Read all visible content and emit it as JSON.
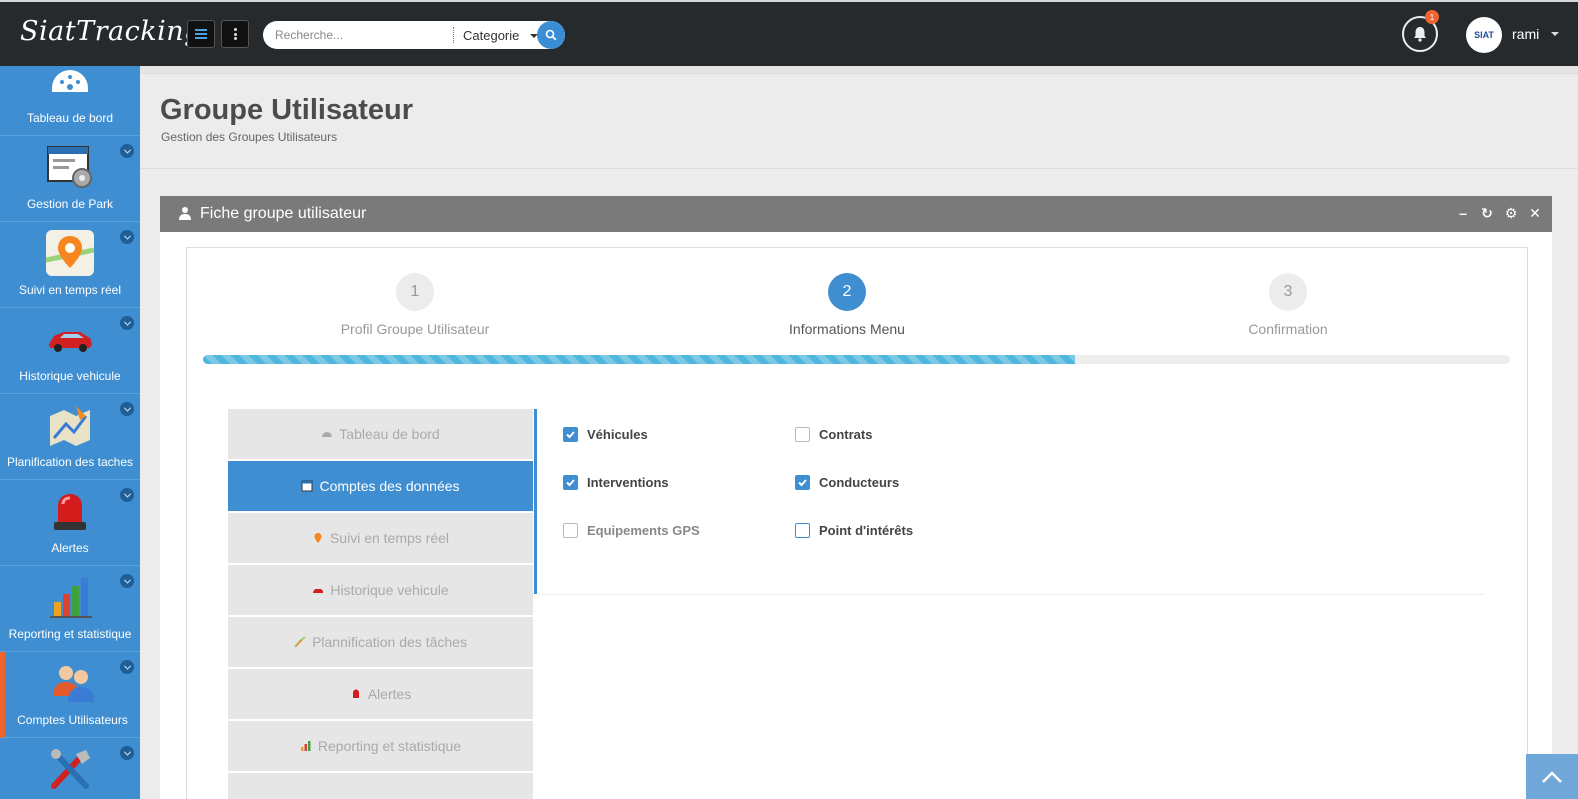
{
  "app": {
    "logo": "SiatTracking"
  },
  "topbar": {
    "search_placeholder": "Recherche...",
    "category": "Categorie",
    "notification_count": "1",
    "avatar_text": "SIAT",
    "username": "rami"
  },
  "sidebar": {
    "items": [
      {
        "label": "Tableau de bord"
      },
      {
        "label": "Gestion de Park"
      },
      {
        "label": "Suivi en temps réel"
      },
      {
        "label": "Historique vehicule"
      },
      {
        "label": "Planification des taches"
      },
      {
        "label": "Alertes"
      },
      {
        "label": "Reporting et statistique"
      },
      {
        "label": "Comptes Utilisateurs"
      },
      {
        "label": ""
      }
    ]
  },
  "page": {
    "title": "Groupe Utilisateur",
    "subtitle": "Gestion des Groupes Utilisateurs"
  },
  "panel": {
    "title": "Fiche groupe utilisateur"
  },
  "wizard": {
    "steps": [
      {
        "num": "1",
        "label": "Profil Groupe Utilisateur"
      },
      {
        "num": "2",
        "label": "Informations Menu"
      },
      {
        "num": "3",
        "label": "Confirmation"
      }
    ],
    "current_step": 2,
    "progress_fraction": 0.667
  },
  "tabs": [
    {
      "label": "Tableau de bord"
    },
    {
      "label": "Comptes des données"
    },
    {
      "label": "Suivi en temps réel"
    },
    {
      "label": "Historique vehicule"
    },
    {
      "label": "Plannification des tâches"
    },
    {
      "label": "Alertes"
    },
    {
      "label": "Reporting et statistique"
    }
  ],
  "options": [
    {
      "label": "Véhicules",
      "checked": true
    },
    {
      "label": "Contrats",
      "checked": false
    },
    {
      "label": "Interventions",
      "checked": true
    },
    {
      "label": "Conducteurs",
      "checked": true
    },
    {
      "label": "Equipements GPS",
      "checked": false
    },
    {
      "label": "Point d'intérêts",
      "checked": false
    }
  ],
  "colors": {
    "primary": "#3e8ed1",
    "accent": "#f0642f",
    "topbar": "#262a2c",
    "progress": "#4fb7dd"
  }
}
